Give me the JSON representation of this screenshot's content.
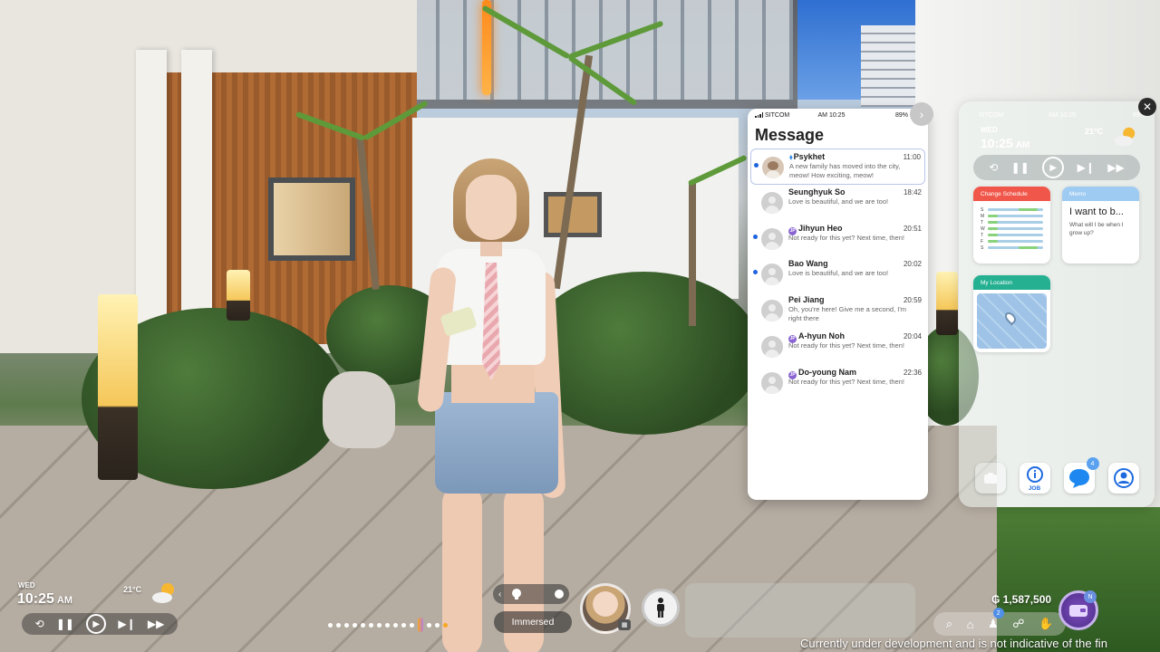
{
  "message_app": {
    "status": {
      "carrier": "SITCOM",
      "time": "AM 10:25",
      "battery": "89%"
    },
    "title": "Message",
    "conversations": [
      {
        "name": "Psykhet",
        "time": "11:00",
        "preview": "A new family has moved into the city, meow! How exciting, meow!",
        "unread": true,
        "icon": "bird-icon",
        "avatar": "cat-avatar"
      },
      {
        "name": "Seunghyuk So",
        "time": "18:42",
        "preview": "Love is beautiful, and we are too!",
        "unread": false
      },
      {
        "name": "Jihyun Heo",
        "time": "20:51",
        "preview": "Not ready for this yet? Next time, then!",
        "unread": true,
        "badge": "JP"
      },
      {
        "name": "Bao Wang",
        "time": "20:02",
        "preview": "Love is beautiful, and we are too!",
        "unread": true
      },
      {
        "name": "Pei Jiang",
        "time": "20:59",
        "preview": "Oh, you're here! Give me a second, I'm right there",
        "unread": false
      },
      {
        "name": "A-hyun Noh",
        "time": "20:04",
        "preview": "Not ready for this yet? Next time, then!",
        "unread": false,
        "badge": "JP"
      },
      {
        "name": "Do-young Nam",
        "time": "22:36",
        "preview": "Not ready for this yet? Next time, then!",
        "unread": false,
        "badge": "JP"
      }
    ]
  },
  "home_screen": {
    "status": {
      "carrier": "SITCOM",
      "time": "AM 10:25",
      "battery": "89%"
    },
    "day": "WED",
    "clock": "10:25",
    "meridiem": "AM",
    "temperature": "21°C",
    "weather_icon": "sun-cloud-icon",
    "widgets": {
      "schedule": {
        "title": "Change Schedule",
        "color": "#f0574a",
        "rows": [
          {
            "day": "S",
            "ranges": [
              [
                0.55,
                0.9
              ]
            ]
          },
          {
            "day": "M",
            "ranges": [
              [
                0.0,
                0.18
              ]
            ]
          },
          {
            "day": "T",
            "ranges": [
              [
                0.0,
                0.18
              ]
            ]
          },
          {
            "day": "W",
            "ranges": [
              [
                0.0,
                0.18
              ]
            ]
          },
          {
            "day": "T",
            "ranges": [
              [
                0.0,
                0.18
              ]
            ]
          },
          {
            "day": "F",
            "ranges": [
              [
                0.0,
                0.18
              ]
            ]
          },
          {
            "day": "S",
            "ranges": [
              [
                0.55,
                0.9
              ]
            ]
          }
        ]
      },
      "memo": {
        "title": "Memo",
        "heading": "I want to b...",
        "body": "What will I be when I grow up?",
        "color": "#9ecbf2"
      },
      "location": {
        "title": "My Location",
        "color": "#25b092"
      }
    },
    "dock": [
      {
        "name": "files-app",
        "label": ""
      },
      {
        "name": "job-app",
        "label": "JOB"
      },
      {
        "name": "messages-app",
        "label": "",
        "badge": "4"
      },
      {
        "name": "profile-app",
        "label": ""
      }
    ]
  },
  "hud": {
    "day": "WED",
    "clock": "10:25",
    "meridiem": "AM",
    "temperature": "21°C",
    "mode_label": "Immersed",
    "money": "₲ 1,587,500",
    "toolbar_badge": "2",
    "inventory_badge": "N",
    "dev_notice": "Currently under development and is not indicative of the fin"
  },
  "colors": {
    "accent_blue": "#1e63e0",
    "badge_purple": "#8a63d2",
    "timeline_active": "#f5a623"
  }
}
